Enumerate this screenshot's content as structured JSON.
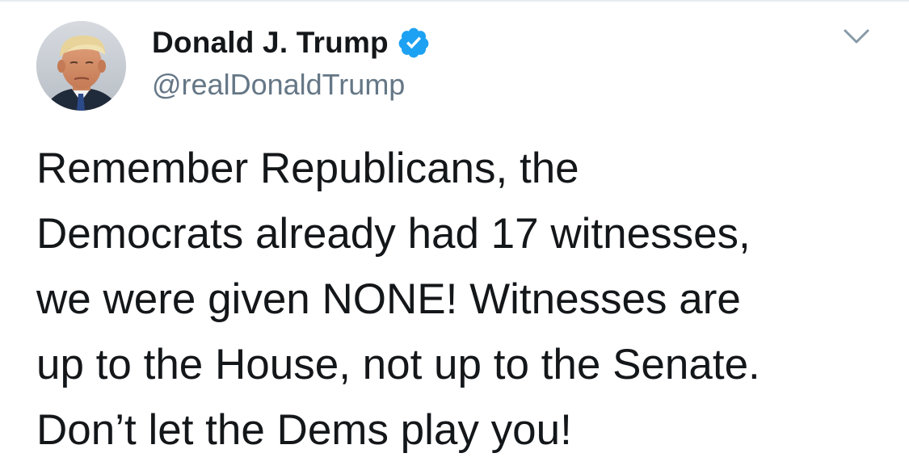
{
  "tweet": {
    "display_name": "Donald J. Trump",
    "handle": "@realDonaldTrump",
    "verified": true,
    "icons": {
      "avatar": "profile-photo",
      "verified": "verified-badge-icon",
      "menu": "chevron-down-icon"
    },
    "colors": {
      "text": "#14171a",
      "secondary": "#657786",
      "verified_blue": "#1da1f2",
      "border": "#e6ecf0"
    },
    "text_lines": [
      "Remember Republicans, the",
      "Democrats already had 17 witnesses,",
      "we were given NONE! Witnesses are",
      "up to the House, not up to the Senate.",
      "Don’t let the Dems play you!"
    ]
  }
}
